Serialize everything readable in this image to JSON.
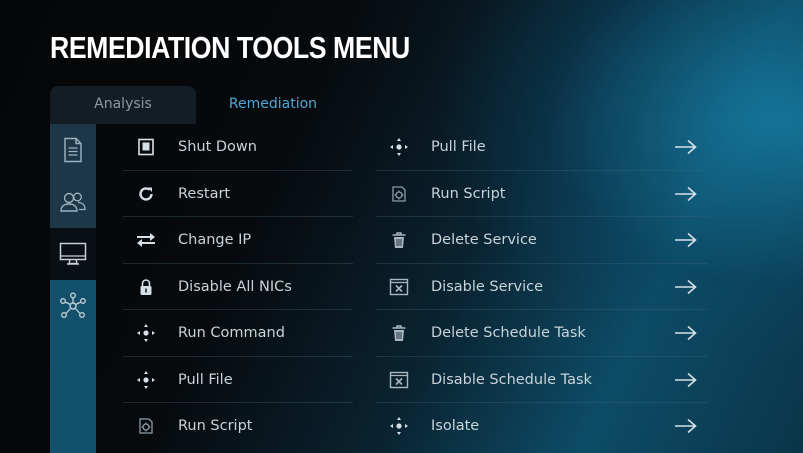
{
  "title": "REMEDIATION TOOLS MENU",
  "tabs": [
    {
      "label": "Analysis",
      "active": false
    },
    {
      "label": "Remediation",
      "active": true
    }
  ],
  "sidebar": {
    "icons": [
      "document-icon",
      "users-icon",
      "monitor-icon",
      "network-icon"
    ],
    "selected_index": 2
  },
  "left_actions": [
    {
      "label": "Shut Down",
      "icon": "power-box-icon"
    },
    {
      "label": "Restart",
      "icon": "restart-icon"
    },
    {
      "label": "Change IP",
      "icon": "swap-arrows-icon"
    },
    {
      "label": "Disable All NICs",
      "icon": "lock-icon"
    },
    {
      "label": "Run Command",
      "icon": "crosshair-icon"
    },
    {
      "label": "Pull File",
      "icon": "crosshair-icon"
    },
    {
      "label": "Run Script",
      "icon": "script-icon"
    }
  ],
  "right_actions": [
    {
      "label": "Pull File",
      "icon": "crosshair-icon"
    },
    {
      "label": "Run Script",
      "icon": "script-icon"
    },
    {
      "label": "Delete Service",
      "icon": "trash-icon"
    },
    {
      "label": "Disable Service",
      "icon": "disable-window-icon"
    },
    {
      "label": "Delete Schedule Task",
      "icon": "trash-icon"
    },
    {
      "label": "Disable Schedule Task",
      "icon": "disable-window-icon"
    },
    {
      "label": "Isolate",
      "icon": "crosshair-icon"
    }
  ],
  "colors": {
    "accent": "#4fa6d6",
    "sidebar": "#12506b",
    "text": "#c8d3da"
  }
}
